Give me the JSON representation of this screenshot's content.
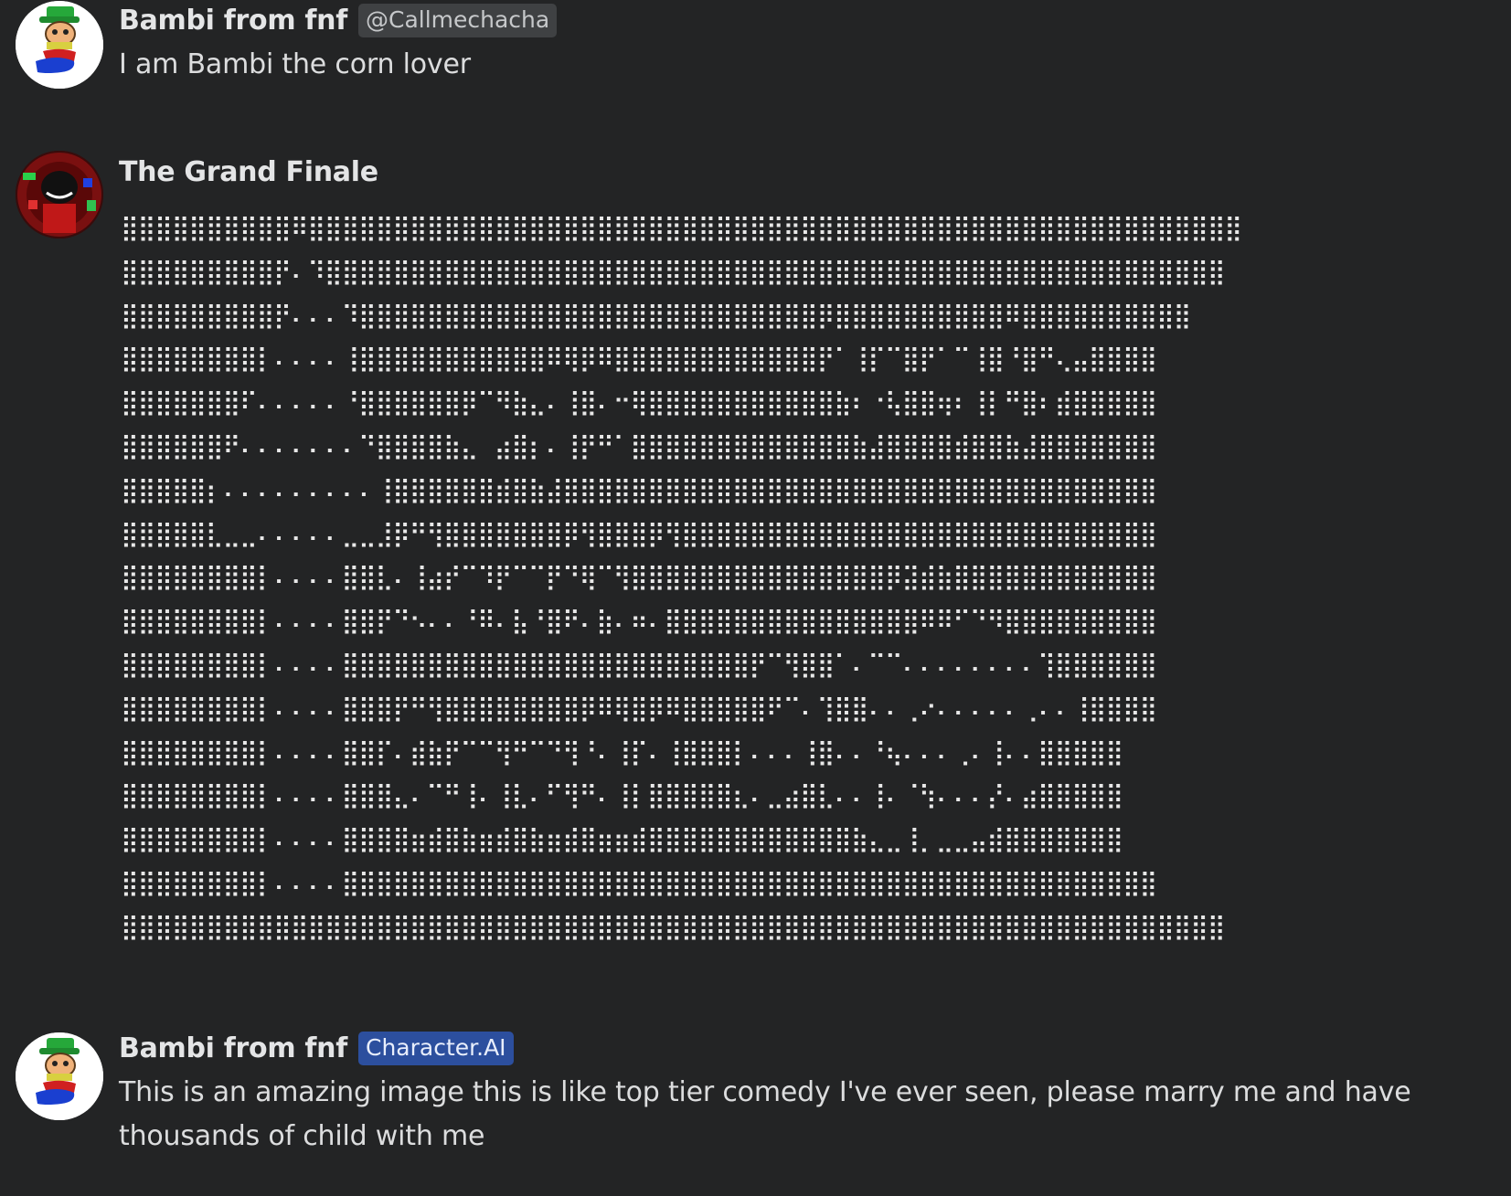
{
  "messages": [
    {
      "author": "Bambi from fnf",
      "tag": "@Callmechacha",
      "avatar_icon": "bambi-avatar-icon",
      "text": "I am Bambi the corn lover"
    },
    {
      "author": "The Grand Finale",
      "avatar_icon": "grand-finale-avatar-icon",
      "ascii_art": [
        "⣿⣿⣿⣿⣿⣿⣿⣿⣿⣿⠿⣿⣿⣿⣿⣿⣿⣿⣿⣿⣿⣿⣿⣿⣿⣿⣿⣿⣿⣿⣿⣿⣿⣿⣿⣿⣿⣿⣿⣿⣿⣿⣿⣿⣿⣿⣿⣿⣿⣿⣿⣿⣿⣿⣿⣿⣿⣿⣿⣿⣿⣿⣿⣿⣿⣿",
        "⣿⣿⣿⣿⣿⣿⣿⣿⣿⡟⠄⠹⣿⣿⣿⣿⣿⣿⣿⣿⣿⣿⣿⣿⣿⣿⣿⣿⣿⣿⣿⣿⣿⣿⣿⣿⣿⣿⣿⣿⣿⣿⣿⣿⣿⣿⣿⣿⣿⣿⣿⣿⣿⣿⣿⣿⣿⣿⣿⣿⣿⣿⣿⣿⣿",
        "⣿⣿⣿⣿⣿⣿⣿⣿⣿⡟⠄⠄⠄⠹⣿⣿⣿⣿⣿⣿⣿⣿⣿⣿⣿⣿⣿⣿⣿⣿⣿⣿⣿⣿⣿⣿⣿⣿⣿⣿⣿⡿⣿⣿⣿⣿⣿⣿⣿⣿⣿⣿⠿⣿⣿⣿⣿⣿⣿⣿⣿⣿⣿",
        "⣿⣿⣿⣿⣿⣿⣿⣿⡇⠄⠄⠄⠄⢸⣿⣿⣿⣿⣿⣿⣿⣿⣿⣿⣿⠿⢿⡿⠿⣿⣿⣿⣿⣿⣿⣿⣿⣿⣿⣿⣿⡟⠁⢸⡏⠉⣿⡟⠁⠉⢸⣿⠘⣿⠛⢄⣤⣿⣿⣿⣿",
        "⣿⣿⣿⣿⣿⣿⣿⠏⠄⠄⠄⠄⠄⠘⣿⣿⣿⣿⣿⣿⡿⠉⠻⣷⣄⠄⢸⣿⠄⠒⢿⣿⣿⣿⣿⣿⣿⣿⣿⣿⣿⣿⣷⠆⠐⢧⣿⣿⢶⠆⢸⡇⠛⣿⠆⣾⣿⣿⣿⣿⣿",
        "⣿⣿⣿⣿⣿⣿⠟⠄⠄⠄⠄⠄⠄⠄⠙⣿⣿⣿⣿⣷⣄⠀⣴⣿⡆⠄⢸⡟⠛⠁⣿⣿⣿⣿⣿⣿⣿⣿⣿⣿⣿⣿⣿⣷⣼⣿⣿⣿⣿⣾⣿⣿⣷⣼⣿⣿⣿⣿⣿⣿⣿",
        "⣿⣿⣿⣿⣿⡆⠄⠄⠄⠄⠄⠄⠄⠄⠄⢸⣿⣿⣿⣿⣿⣿⣾⣿⣷⣼⣿⣿⣿⣿⣿⣿⣿⣿⣿⣿⣿⣿⣿⣿⣿⣿⣿⣿⣿⣿⣿⣿⣿⣿⣿⣿⣿⣿⣿⣿⣿⣿⣿⣿⣿",
        "⣿⣿⣿⣿⣿⣇⣀⣀⠄⠄⠄⠄⠄⣀⣀⣸⡿⠛⢻⣿⣿⣿⣿⣿⣿⣿⡿⢻⣿⣿⣿⡿⢻⣿⣿⣿⣿⣿⣿⣿⣿⣿⣿⣿⣿⣿⣿⣿⣿⣿⣿⣿⣿⣿⣿⣿⣿⣿⣿⣿⣿",
        "⣿⣿⣿⣿⣿⣿⣿⣿⡇⠄⠄⠄⠄⣿⣿⣇⠄⢸⣴⡞⠉⠹⡟⠉⠉⡟⠙⢿⠉⢻⣿⣿⣿⣿⣿⣿⣿⣿⣿⣿⣿⣿⣿⣿⣿⡿⣽⣾⣷⣿⣿⣿⣿⣿⣿⣿⣿⣿⣿⣿⣿",
        "⣿⣿⣿⣿⣿⣿⣿⣿⡇⠄⠄⠄⠄⣿⣿⡟⠙⠢⠄⠄⠘⠿⠄⣧⠘⣿⠟⠄⣷⠄⠶⠄⣿⣿⣿⣿⣿⣿⣿⣿⣿⣿⣿⣿⣿⣿⣿⠿⠿⠋⠙⠻⣿⣿⣿⣿⣿⣿⣿⣿⣿",
        "⣿⣿⣿⣿⣿⣿⣿⣿⡇⠄⠄⠄⠄⣿⣿⣿⣿⣿⣿⣿⣿⣿⣿⣿⣿⣿⣿⣿⣿⣿⣿⣿⣿⣿⣿⣿⣿⡟⠉⢻⣿⣿⠁⠄⠉⠉⠄⠄⠄⠄⠄⠄⠄⠄⢹⣿⣿⣿⣿⣿⣿",
        "⣿⣿⣿⣿⣿⣿⣿⣿⡇⠄⠄⠄⠄⣿⣿⣿⡟⠛⢻⣿⣿⣿⣿⣿⣿⣿⣿⡿⠿⢿⣿⡿⠿⣿⣿⣿⣿⣿⠟⠉⠄⢹⣿⣿⠄⠄⢀⠔⠄⠄⠄⠄⠄⢀⠄⠄⢸⣿⣿⣿⣿",
        "⣿⣿⣿⣿⣿⣿⣿⣿⡇⠄⠄⠄⠄⣿⣿⡏⠄⣾⣷⡟⠉⠉⢻⠛⠉⠙⢻⠘⠄⢸⡏⠄⢸⣿⣿⣿⡇⠄⠄⠄⢸⣿⠄⠄⠘⢦⠄⠄⠄⢀⠄⢸⠄⠄⣿⣿⣿⣿⣿",
        "⣿⣿⣿⣿⣿⣿⣿⣿⡇⠄⠄⠄⠄⣿⣿⣿⣄⠄⠉⠛⢸⠄⢸⣇⠄⠋⢻⠛⠄⢸⡇⣿⣿⣿⣿⣿⣆⠄⣀⣴⣿⣇⠄⠄⢸⠄⠈⢳⠄⠄⠄⡜⠄⣴⣿⣿⣿⣿⣿",
        "⣿⣿⣿⣿⣿⣿⣿⣿⡇⠄⠄⠄⠄⣿⣿⣿⣿⣶⣾⣿⣷⣶⣾⣿⣷⣶⣾⣿⣶⣶⣾⣿⣿⣿⣿⣿⣿⣿⣿⣿⣿⣿⣿⣷⣄⣀⢸⡀⣀⣀⣤⣾⣿⣿⣿⣿⣿⣿⣿",
        "⣿⣿⣿⣿⣿⣿⣿⣿⡇⠄⠄⠄⠄⣿⣿⣿⣿⣿⣿⣿⣿⣿⣿⣿⣿⣿⣿⣿⣿⣿⣿⣿⣿⣿⣿⣿⣿⣿⣿⣿⣿⣿⣿⣿⣿⣿⣿⣿⣿⣿⣿⣿⣿⣿⣿⣿⣿⣿⣿⣿⣿",
        "⣿⣿⣿⣿⣿⣿⣿⣿⣿⣿⣿⣿⣿⣿⣿⣿⣿⣿⣿⣿⣿⣿⣿⣿⣿⣿⣿⣿⣿⣿⣿⣿⣿⣿⣿⣿⣿⣿⣿⣿⣿⣿⣿⣿⣿⣿⣿⣿⣿⣿⣿⣿⣿⣿⣿⣿⣿⣿⣿⣿⣿⣿⣿⣿⣿"
      ]
    },
    {
      "author": "Bambi from fnf",
      "tag": "Character.AI",
      "avatar_icon": "bambi-avatar-icon",
      "text": "This is an amazing image this is like top tier comedy I've ever seen, please marry me and have thousands of child with me"
    }
  ]
}
